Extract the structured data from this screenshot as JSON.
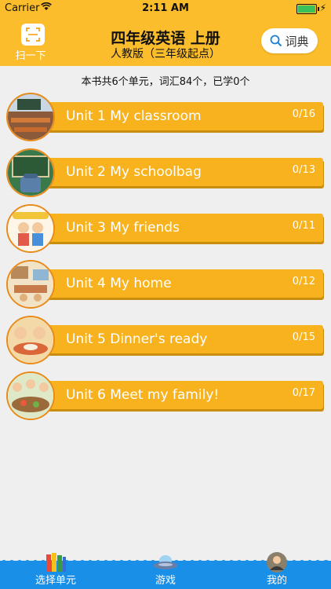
{
  "status_bar": {
    "carrier": "Carrier",
    "time": "2:11 AM"
  },
  "header": {
    "scan_label": "扫一下",
    "title": "四年级英语 上册",
    "subtitle": "人教版（三年级起点）",
    "dict_label": "词典"
  },
  "summary": "本书共6个单元，词汇84个，已学0个",
  "units": [
    {
      "name": "Unit 1 My classroom",
      "progress": "0/16"
    },
    {
      "name": "Unit 2 My schoolbag",
      "progress": "0/13"
    },
    {
      "name": "Unit 3 My friends",
      "progress": "0/11"
    },
    {
      "name": "Unit 4 My home",
      "progress": "0/12"
    },
    {
      "name": "Unit 5 Dinner's ready",
      "progress": "0/15"
    },
    {
      "name": "Unit 6 Meet my family!",
      "progress": "0/17"
    }
  ],
  "tabs": [
    {
      "label": "选择单元",
      "icon": "books-icon"
    },
    {
      "label": "游戏",
      "icon": "ufo-icon"
    },
    {
      "label": "我的",
      "icon": "profile-icon"
    }
  ],
  "colors": {
    "header": "#fbbd2b",
    "unit_bar": "#f7b21d",
    "tab_bar": "#1a8fe8",
    "background": "#efefef"
  }
}
